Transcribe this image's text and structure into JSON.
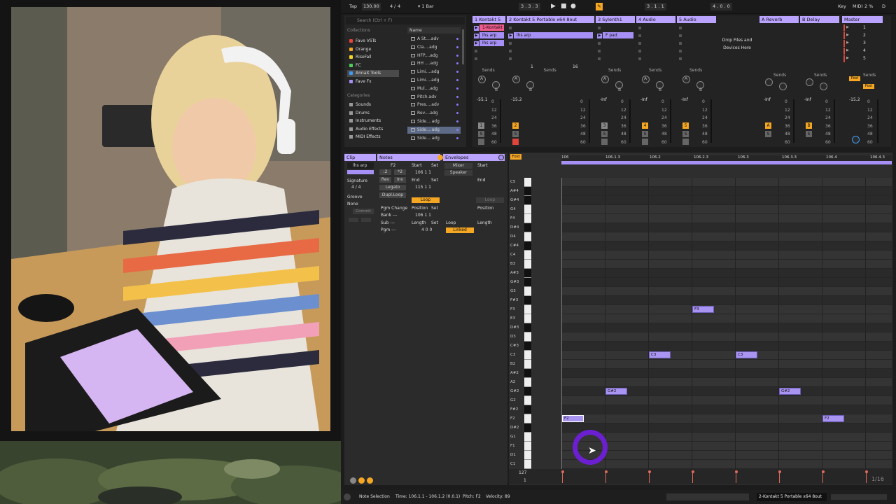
{
  "topbar": {
    "tap": "Tap",
    "tempo": "130.00",
    "sig_num": "4",
    "sig_den": "4",
    "quantize": "1 Bar",
    "position": "3 . 3 . 3",
    "loop_pos": "3 . 1 . 1",
    "loop_len": "4 . 0 . 0",
    "key": "Key",
    "midi": "MIDI",
    "cpu": "2 %",
    "d": "D"
  },
  "browser": {
    "search_placeholder": "Search (Ctrl + F)",
    "collections_header": "Collections",
    "collections": [
      {
        "label": "Fave VSTs",
        "color": "#e8453c"
      },
      {
        "label": "Orange",
        "color": "#f5a623"
      },
      {
        "label": "RiseFall",
        "color": "#f5d623"
      },
      {
        "label": "FC",
        "color": "#4ecb5a"
      },
      {
        "label": "AnnaX Tools",
        "color": "#3d9bf5"
      },
      {
        "label": "Fave Fx",
        "color": "#a690f6"
      }
    ],
    "categories_header": "Categories",
    "categories": [
      "Sounds",
      "Drums",
      "Instruments",
      "Audio Effects",
      "MIDI Effects"
    ],
    "name_header": "Name",
    "files": [
      "A St....adv",
      "Cla....adg",
      "HFP....adg",
      "HH ....adg",
      "Limi....adg",
      "Limi....adg",
      "Mul....adg",
      "Pitch.adv",
      "Pres....adv",
      "Rev....adg",
      "Side....adg",
      "Side....adg",
      "Side....adg"
    ]
  },
  "tracks": [
    {
      "name": "1 Kontakt 5",
      "clips": [
        "1-Kontakt",
        "lhs arp",
        "lhs arp"
      ],
      "num": "1",
      "vol": "-55.1",
      "armed": false
    },
    {
      "name": "2 Kontakt 5 Portable x64 8out",
      "clips": [
        "",
        "lhs arp",
        ""
      ],
      "num": "2",
      "vol": "-15.2",
      "armed": true
    },
    {
      "name": "3 Sylenth1",
      "clips": [
        "",
        "F pad",
        ""
      ],
      "num": "3",
      "vol": "-Inf",
      "armed": false
    },
    {
      "name": "4 Audio",
      "clips": [
        "",
        "",
        ""
      ],
      "num": "4",
      "vol": "-Inf",
      "armed": true
    },
    {
      "name": "5 Audio",
      "clips": [
        "",
        "",
        ""
      ],
      "num": "5",
      "vol": "-Inf",
      "armed": true
    }
  ],
  "clip_nums": [
    "1",
    "16"
  ],
  "drop_text": "Drop Files and Devices Here",
  "returns": [
    {
      "name": "A Reverb",
      "letter": "A",
      "vol": "-Inf"
    },
    {
      "name": "B Delay",
      "letter": "B",
      "vol": "-Inf"
    }
  ],
  "master": {
    "name": "Master",
    "scenes": [
      "1",
      "2",
      "3",
      "4",
      "5"
    ],
    "vol": "-15.2",
    "post": "Post"
  },
  "mixer_labels": {
    "sends": "Sends",
    "a": "A",
    "b": "B",
    "s": "S",
    "scale": [
      "0",
      "12",
      "24",
      "36",
      "48",
      "60"
    ]
  },
  "clip_view": {
    "clip_tab": "Clip",
    "clip_name": "lhs arp",
    "signature_label": "Signature",
    "sig": "4 / 4",
    "groove_label": "Groove",
    "groove_val": "None",
    "commit": "Commit",
    "notes_tab": "Notes",
    "note_val": "F2",
    "start_label": "Start",
    "set_label": "Set",
    "start_val": "106 1 1",
    "end_label": "End",
    "end_val": "115 1 1",
    "half": ":2",
    "double": "*2",
    "rev": "Rev",
    "inv": "Inv",
    "legato": "Legato",
    "dupl_loop": "Dupl.Loop",
    "loop_btn": "Loop",
    "pgm_change": "Pgm Change",
    "bank": "Bank ---",
    "sub": "Sub ---",
    "pgm": "Pgm ---",
    "position_label": "Position",
    "position_val": "106 1 1",
    "length_label": "Length",
    "length_val": "4 0 0",
    "envelopes_tab": "Envelopes",
    "env_device": "Mixer",
    "env_param": "Speaker",
    "env_start": "Start",
    "env_end": "End",
    "env_loop": "Loop",
    "env_linked": "Linked",
    "env_position": "Position",
    "env_length": "Length",
    "fold": "Fold"
  },
  "ruler": [
    "106",
    "106.1.3",
    "106.2",
    "106.2.3",
    "106.3",
    "106.3.3",
    "106.4",
    "106.4.3"
  ],
  "keys": [
    "C5",
    "A#4",
    "G#4",
    "G4",
    "F4",
    "D#4",
    "D4",
    "C#4",
    "C4",
    "B3",
    "A#3",
    "G#3",
    "G3",
    "F#3",
    "F3",
    "E3",
    "D#3",
    "D3",
    "C#3",
    "C3",
    "B2",
    "A#2",
    "A2",
    "G#2",
    "G2",
    "F#2",
    "F2",
    "D#2",
    "G1",
    "F1",
    "D1",
    "C1"
  ],
  "notes": [
    {
      "label": "F3",
      "key": "F3",
      "start": 0.75,
      "len": 0.125
    },
    {
      "label": "C3",
      "key": "C3",
      "start": 0.5,
      "len": 0.125
    },
    {
      "label": "C3",
      "key": "C3",
      "start": 1.0,
      "len": 0.125
    },
    {
      "label": "G#2",
      "key": "G#2",
      "start": 0.25,
      "len": 0.125
    },
    {
      "label": "G#2",
      "key": "G#2",
      "start": 1.25,
      "len": 0.125
    },
    {
      "label": "F2",
      "key": "F2",
      "start": 0.0,
      "len": 0.125
    },
    {
      "label": "F2",
      "key": "F2",
      "start": 1.5,
      "len": 0.125
    }
  ],
  "velocity": {
    "max": "127",
    "min": "1",
    "page": "1/16"
  },
  "statusbar": {
    "mode": "Note Selection",
    "time": "Time: 106.1.1 - 106.1.2 (0.0.1)",
    "pitch": "Pitch: F2",
    "velocity": "Velocity: 89",
    "track": "2-Kontakt 5 Portable x64 8out"
  }
}
